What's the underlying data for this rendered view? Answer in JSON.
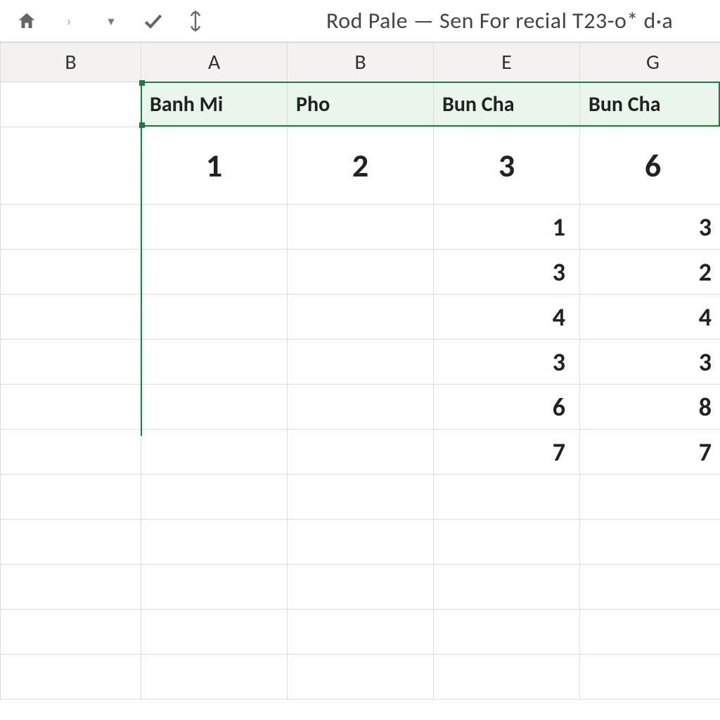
{
  "toolbar": {
    "title": "Rod Pale — Sen For recial T23-o* d·a"
  },
  "columns": [
    "B",
    "A",
    "B",
    "E",
    "G"
  ],
  "header_row": [
    "Banh Mi",
    "Pho",
    "Bun Cha",
    "Bun Cha"
  ],
  "big_row": [
    "1",
    "2",
    "3",
    "6"
  ],
  "data_rows": [
    [
      "",
      "",
      "1",
      "3"
    ],
    [
      "",
      "",
      "3",
      "2"
    ],
    [
      "",
      "",
      "4",
      "4"
    ],
    [
      "",
      "",
      "3",
      "3"
    ],
    [
      "",
      "",
      "6",
      "8"
    ],
    [
      "",
      "",
      "7",
      "7"
    ]
  ],
  "colors": {
    "accent": "#1a7f43",
    "header_bg": "#eaf5ec"
  }
}
